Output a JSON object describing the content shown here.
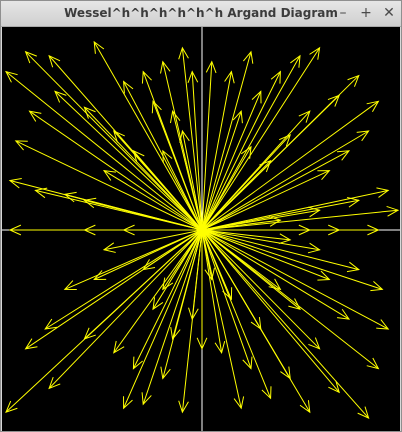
{
  "window": {
    "title": "Wessel^h^h^h^h^h^h Argand Diagram",
    "minimize_glyph": "–",
    "maximize_glyph": "+",
    "close_glyph": "✕"
  },
  "diagram": {
    "background_color": "#000000",
    "axis_color": "#ffffff",
    "vector_color": "#ffff00",
    "description_note": "",
    "vectors": [
      [
        -1.0,
        0.8
      ],
      [
        -0.9,
        0.9
      ],
      [
        -0.95,
        0.45
      ],
      [
        -0.98,
        0.25
      ],
      [
        -0.85,
        0.2
      ],
      [
        -0.7,
        0.18
      ],
      [
        -0.6,
        0.15
      ],
      [
        -0.5,
        0.3
      ],
      [
        -0.88,
        0.6
      ],
      [
        -0.75,
        0.7
      ],
      [
        -0.6,
        0.62
      ],
      [
        -0.45,
        0.5
      ],
      [
        -0.4,
        0.75
      ],
      [
        -0.55,
        0.95
      ],
      [
        -0.78,
        0.88
      ],
      [
        -0.3,
        0.8
      ],
      [
        -0.2,
        0.85
      ],
      [
        -0.1,
        0.92
      ],
      [
        -0.25,
        0.65
      ],
      [
        -0.15,
        0.6
      ],
      [
        -0.35,
        0.4
      ],
      [
        -0.2,
        0.4
      ],
      [
        -0.1,
        0.5
      ],
      [
        -0.05,
        0.8
      ],
      [
        0.05,
        0.85
      ],
      [
        0.15,
        0.8
      ],
      [
        0.25,
        0.9
      ],
      [
        0.3,
        0.7
      ],
      [
        0.4,
        0.8
      ],
      [
        0.5,
        0.88
      ],
      [
        0.6,
        0.92
      ],
      [
        0.8,
        0.78
      ],
      [
        0.7,
        0.68
      ],
      [
        0.55,
        0.6
      ],
      [
        0.45,
        0.48
      ],
      [
        0.35,
        0.35
      ],
      [
        0.25,
        0.42
      ],
      [
        0.2,
        0.6
      ],
      [
        0.9,
        0.65
      ],
      [
        0.85,
        0.5
      ],
      [
        0.75,
        0.4
      ],
      [
        0.65,
        0.3
      ],
      [
        0.95,
        0.2
      ],
      [
        0.8,
        0.15
      ],
      [
        0.6,
        0.1
      ],
      [
        0.4,
        0.05
      ],
      [
        1.0,
        0.1
      ],
      [
        0.9,
        0.0
      ],
      [
        0.7,
        0.0
      ],
      [
        0.55,
        0.0
      ],
      [
        -0.6,
        0.0
      ],
      [
        -0.4,
        0.0
      ],
      [
        -0.98,
        0.0
      ],
      [
        0.45,
        -0.05
      ],
      [
        0.6,
        -0.1
      ],
      [
        0.8,
        -0.2
      ],
      [
        0.92,
        -0.3
      ],
      [
        -1.0,
        -0.92
      ],
      [
        -0.9,
        -0.6
      ],
      [
        -0.8,
        -0.5
      ],
      [
        -0.7,
        -0.3
      ],
      [
        -0.55,
        -0.25
      ],
      [
        -0.6,
        -0.55
      ],
      [
        -0.45,
        -0.62
      ],
      [
        -0.78,
        -0.8
      ],
      [
        -0.35,
        -0.7
      ],
      [
        -0.4,
        -0.9
      ],
      [
        -0.3,
        -0.88
      ],
      [
        -0.2,
        -0.75
      ],
      [
        -0.1,
        -0.92
      ],
      [
        -0.15,
        -0.55
      ],
      [
        -0.25,
        -0.4
      ],
      [
        -0.05,
        -0.45
      ],
      [
        0.0,
        -0.6
      ],
      [
        0.1,
        -0.62
      ],
      [
        0.2,
        -0.9
      ],
      [
        0.25,
        -0.7
      ],
      [
        0.3,
        -0.5
      ],
      [
        0.35,
        -0.85
      ],
      [
        0.45,
        -0.75
      ],
      [
        0.55,
        -0.92
      ],
      [
        0.6,
        -0.6
      ],
      [
        0.7,
        -0.82
      ],
      [
        0.85,
        -0.95
      ],
      [
        0.9,
        -0.7
      ],
      [
        0.95,
        -0.5
      ],
      [
        0.75,
        -0.45
      ],
      [
        0.5,
        -0.4
      ],
      [
        0.4,
        -0.3
      ],
      [
        0.65,
        -0.25
      ],
      [
        -0.3,
        -0.2
      ],
      [
        -0.5,
        -0.1
      ],
      [
        -0.2,
        -0.3
      ],
      [
        0.15,
        -0.35
      ],
      [
        0.05,
        -0.25
      ]
    ]
  }
}
